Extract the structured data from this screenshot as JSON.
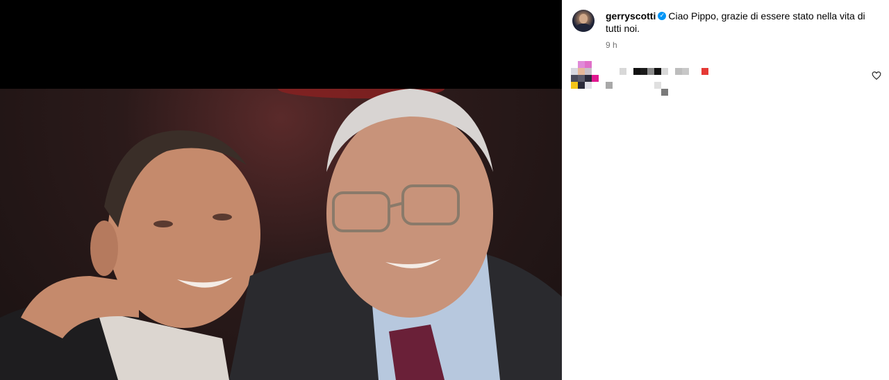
{
  "post": {
    "username": "gerryscotti",
    "verified_icon": "verified-badge-icon",
    "caption": "Ciao Pippo, grazie di essere stato nella vita di tutti noi.",
    "timestamp": "9 h"
  },
  "comment": {
    "like_icon": "heart-icon"
  },
  "colors": {
    "verified": "#0095f6",
    "timestamp": "#737373",
    "pixel_red": "#e53935",
    "pixel_pink": "#e040a0",
    "pixel_yellow": "#f5c518"
  }
}
